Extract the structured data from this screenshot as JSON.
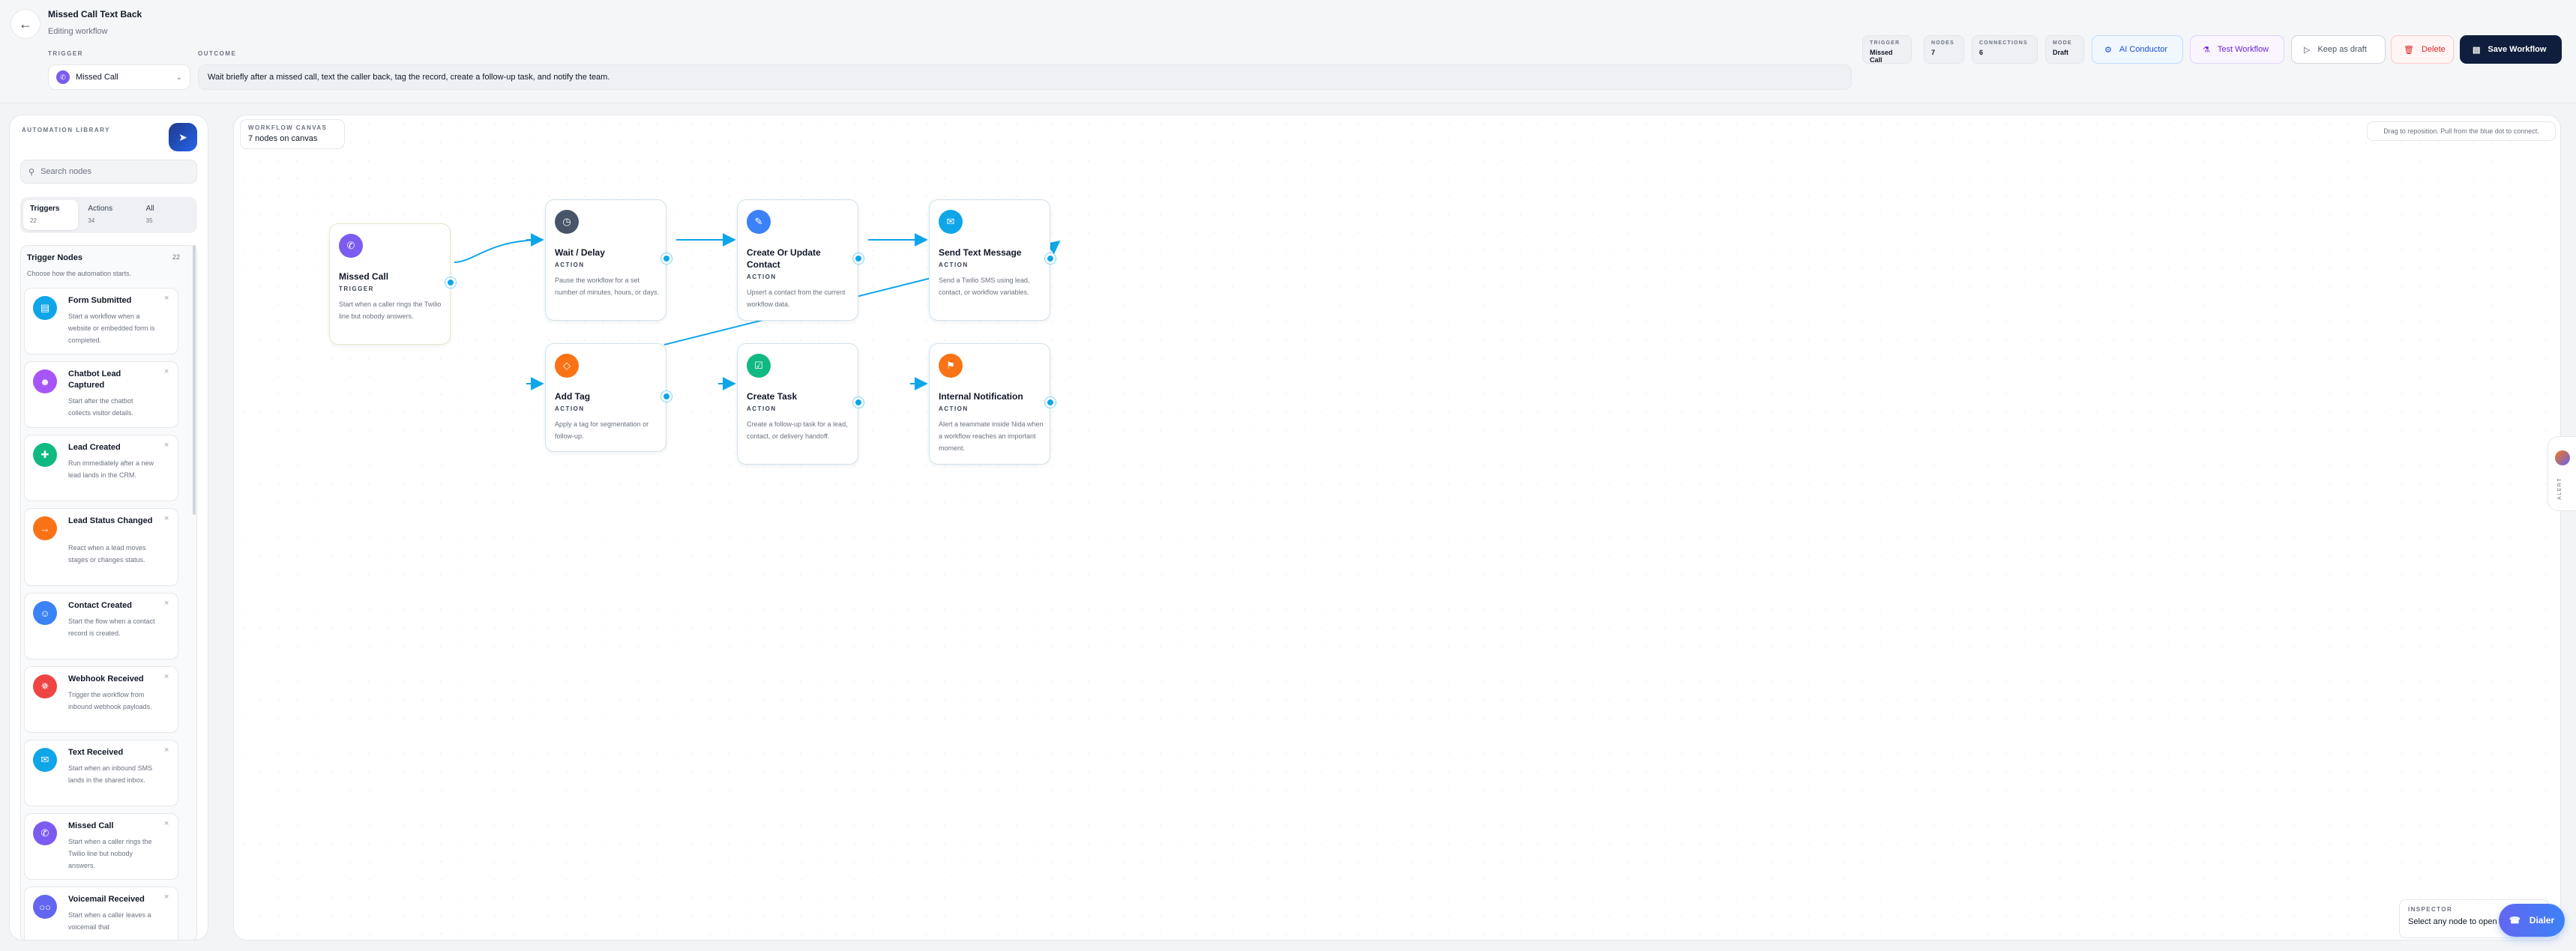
{
  "header": {
    "title": "Missed Call Text Back",
    "subtitle": "Editing workflow",
    "back_icon": "arrow-left-icon",
    "trigger_label": "TRIGGER",
    "trigger_value": "Missed Call",
    "outcome_label": "OUTCOME",
    "outcome_value": "Wait briefly after a missed call, text the caller back, tag the record, create a follow-up task, and notify the team.",
    "stats": [
      {
        "label": "TRIGGER",
        "value": "Missed Call"
      },
      {
        "label": "NODES",
        "value": "7"
      },
      {
        "label": "CONNECTIONS",
        "value": "6"
      },
      {
        "label": "MODE",
        "value": "Draft"
      }
    ],
    "buttons": {
      "ai": "AI Conductor",
      "test": "Test Workflow",
      "draft": "Keep as draft",
      "delete": "Delete",
      "save": "Save Workflow"
    }
  },
  "sidebar": {
    "title": "AUTOMATION LIBRARY",
    "search_placeholder": "Search nodes",
    "tabs": [
      {
        "label": "Triggers",
        "count": "22"
      },
      {
        "label": "Actions",
        "count": "34"
      },
      {
        "label": "All",
        "count": "35"
      }
    ],
    "section_title": "Trigger Nodes",
    "section_count": "22",
    "section_desc": "Choose how the automation starts.",
    "items": [
      {
        "title": "Form Submitted",
        "desc": "Start a workflow when a website or embedded form is completed.",
        "color": "#0ea5e9"
      },
      {
        "title": "Chatbot Lead Captured",
        "desc": "Start after the chatbot collects visitor details.",
        "color": "#a855f7"
      },
      {
        "title": "Lead Created",
        "desc": "Run immediately after a new lead lands in the CRM.",
        "color": "#10b981"
      },
      {
        "title": "Lead Status Changed",
        "desc": "React when a lead moves stages or changes status.",
        "color": "#f97316"
      },
      {
        "title": "Contact Created",
        "desc": "Start the flow when a contact record is created.",
        "color": "#3b82f6"
      },
      {
        "title": "Webhook Received",
        "desc": "Trigger the workflow from inbound webhook payloads.",
        "color": "#ef4444"
      },
      {
        "title": "Text Received",
        "desc": "Start when an inbound SMS lands in the shared inbox.",
        "color": "#0ea5e9"
      },
      {
        "title": "Missed Call",
        "desc": "Start when a caller rings the Twilio line but nobody answers.",
        "color": "#7c5cf0"
      },
      {
        "title": "Voicemail Received",
        "desc": "Start when a caller leaves a voicemail that",
        "color": "#6366f1"
      }
    ]
  },
  "canvas": {
    "chip_label": "WORKFLOW CANVAS",
    "chip_value": "7 nodes on canvas",
    "hint": "Drag to reposition. Pull from the blue dot to connect.",
    "nodes": [
      {
        "title": "Missed Call",
        "kind": "TRIGGER",
        "desc": "Start when a caller rings the Twilio line but nobody answers.",
        "color": "#7c5cf0",
        "icon": "phone-missed-icon"
      },
      {
        "title": "Wait / Delay",
        "kind": "ACTION",
        "desc": "Pause the workflow for a set number of minutes, hours, or days.",
        "color": "#475569",
        "icon": "clock-icon"
      },
      {
        "title": "Create Or Update Contact",
        "kind": "ACTION",
        "desc": "Upsert a contact from the current workflow data.",
        "color": "#3b82f6",
        "icon": "user-edit-icon"
      },
      {
        "title": "Send Text Message",
        "kind": "ACTION",
        "desc": "Send a Twilio SMS using lead, contact, or workflow variables.",
        "color": "#0ea5e9",
        "icon": "message-icon"
      },
      {
        "title": "Add Tag",
        "kind": "ACTION",
        "desc": "Apply a tag for segmentation or follow-up.",
        "color": "#f97316",
        "icon": "tag-icon"
      },
      {
        "title": "Create Task",
        "kind": "ACTION",
        "desc": "Create a follow-up task for a lead, contact, or delivery handoff.",
        "color": "#10b981",
        "icon": "task-icon"
      },
      {
        "title": "Internal Notification",
        "kind": "ACTION",
        "desc": "Alert a teammate inside Nida when a workflow reaches an important moment.",
        "color": "#f97316",
        "icon": "bell-icon"
      }
    ]
  },
  "inspector": {
    "label": "INSPECTOR",
    "value": "Select any node to open its settings."
  },
  "dialer": {
    "label": "Dialer"
  },
  "side_tab": {
    "label": "ALERT"
  }
}
